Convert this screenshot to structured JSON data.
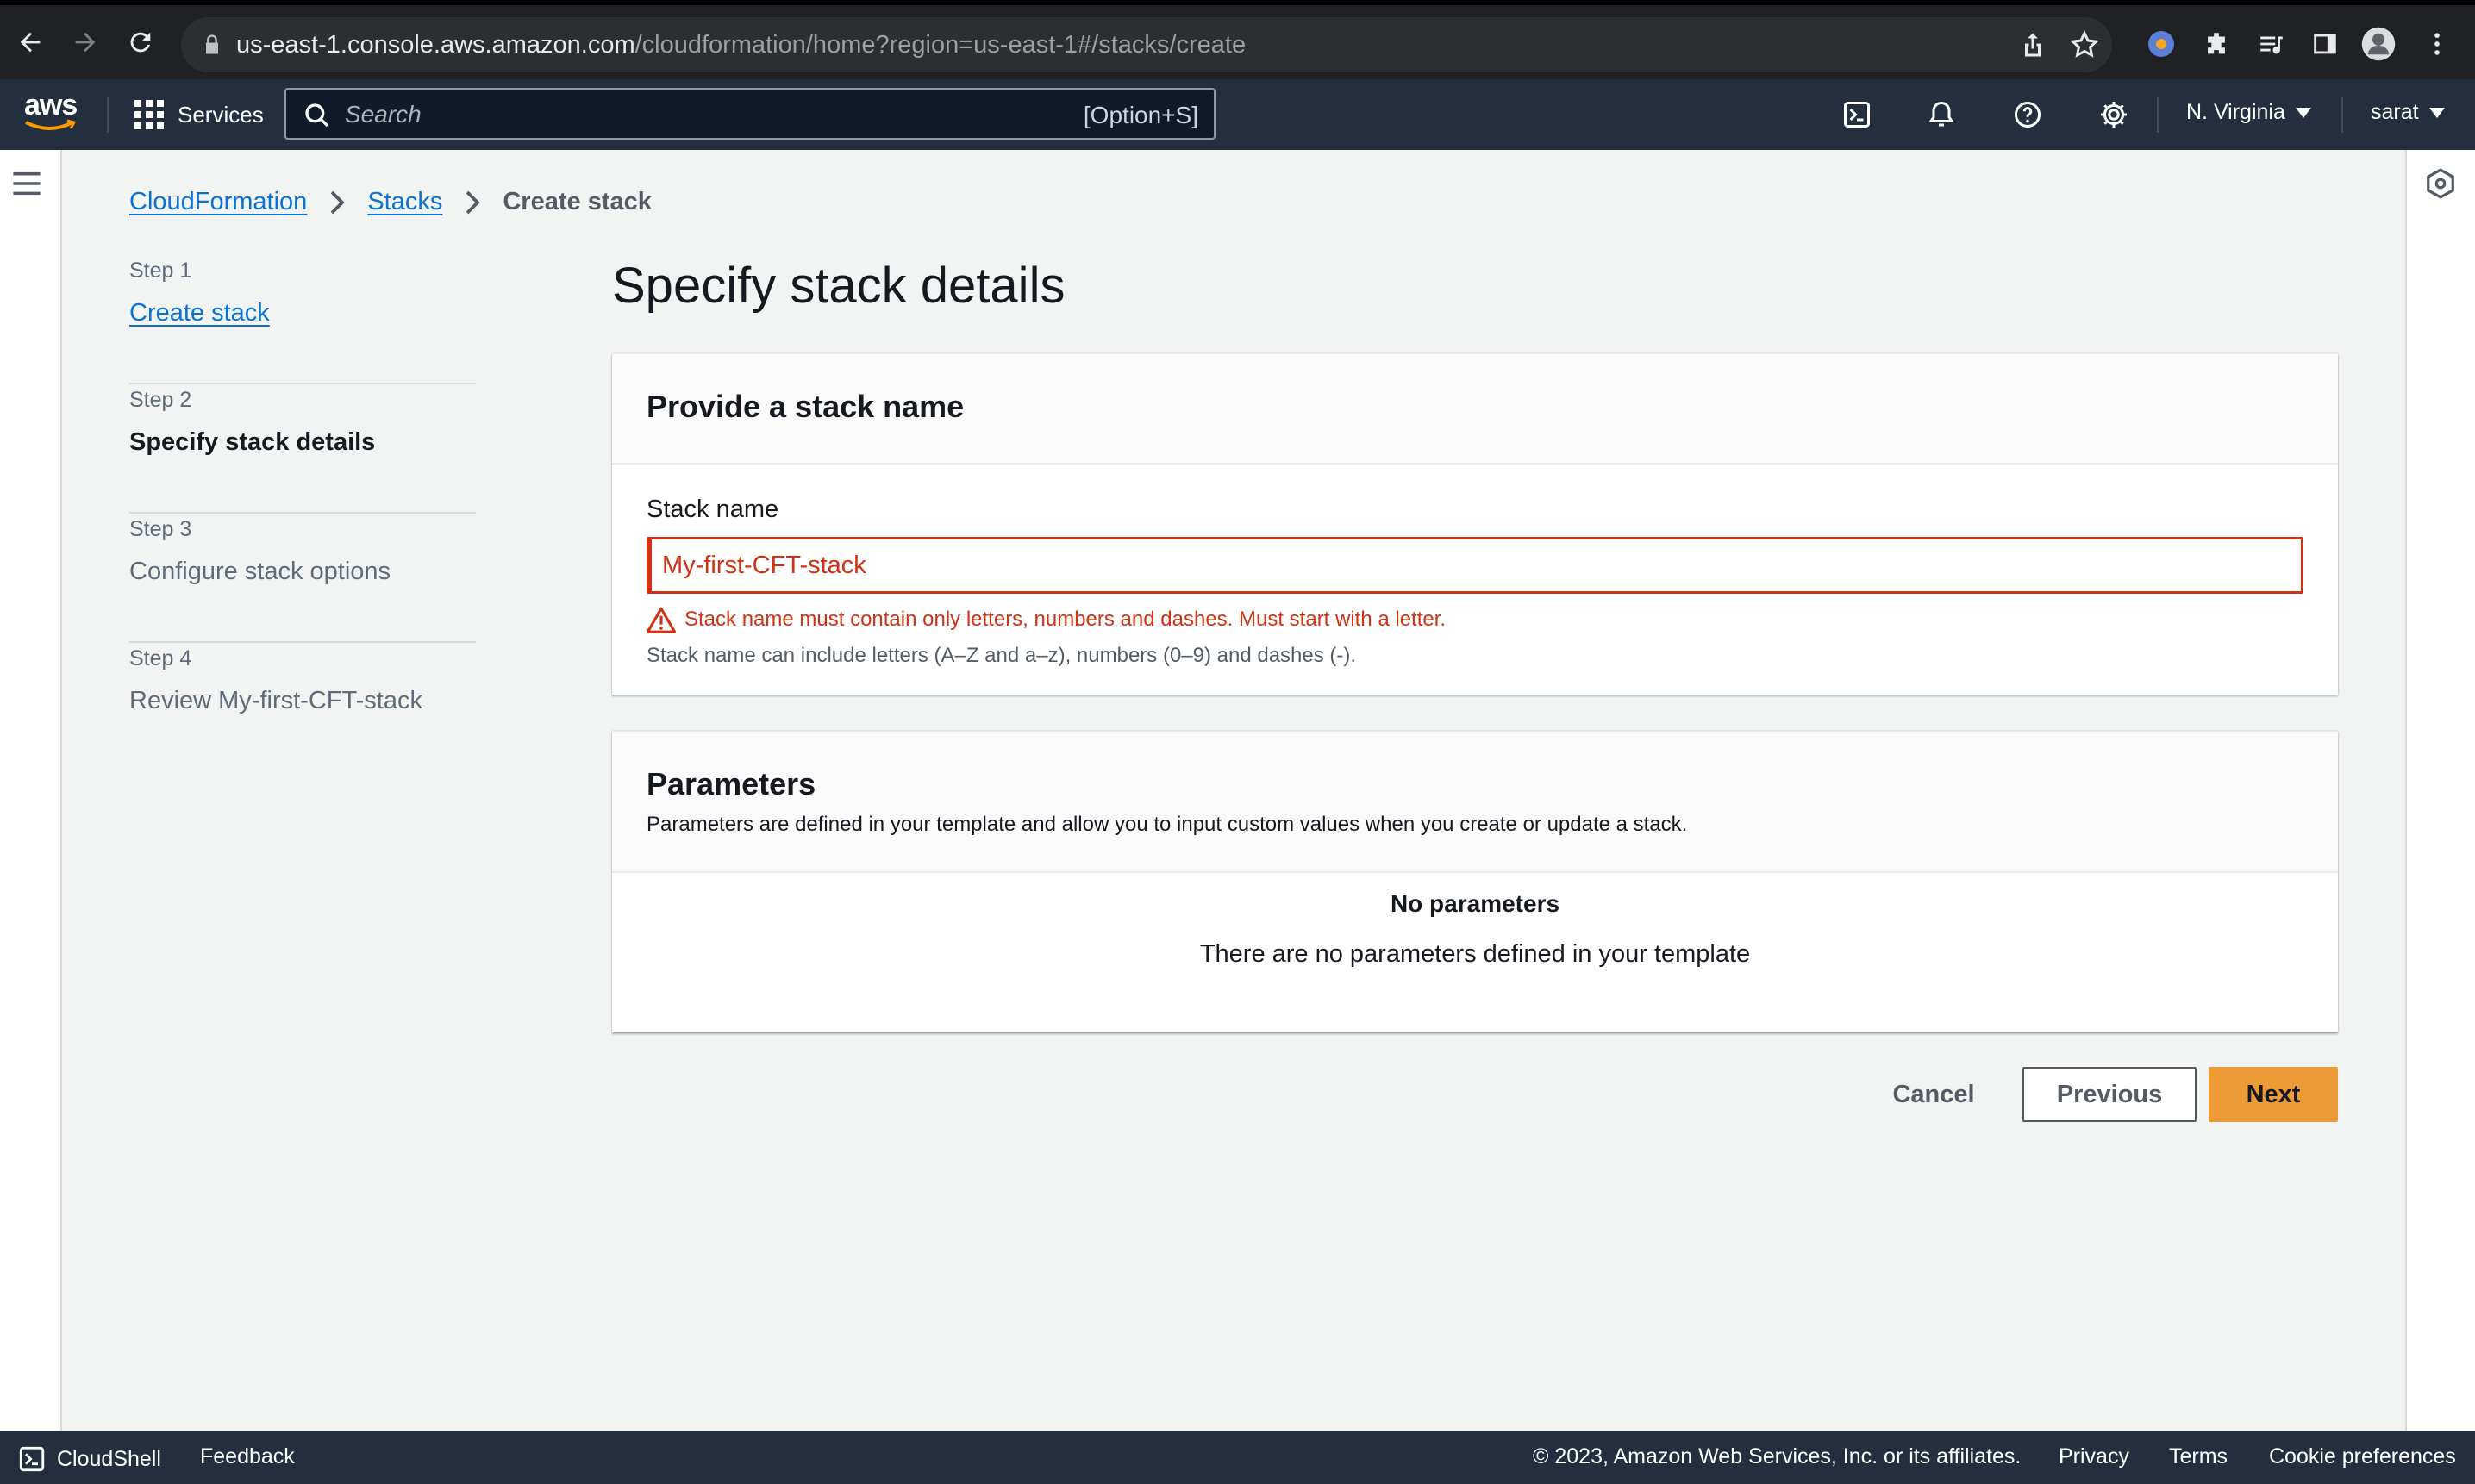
{
  "browser": {
    "url_host": "us-east-1.console.aws.amazon.com",
    "url_path": "/cloudformation/home?region=us-east-1#/stacks/create"
  },
  "header": {
    "logo_text": "aws",
    "services_label": "Services",
    "search_placeholder": "Search",
    "search_shortcut": "[Option+S]",
    "region_label": "N. Virginia",
    "user_label": "sarat"
  },
  "breadcrumb": {
    "items": [
      "CloudFormation",
      "Stacks"
    ],
    "current": "Create stack"
  },
  "steps": [
    {
      "number": "Step 1",
      "title": "Create stack"
    },
    {
      "number": "Step 2",
      "title": "Specify stack details"
    },
    {
      "number": "Step 3",
      "title": "Configure stack options"
    },
    {
      "number": "Step 4",
      "title": "Review My-first-CFT-stack"
    }
  ],
  "main": {
    "title": "Specify stack details",
    "stack_name_panel": {
      "heading": "Provide a stack name",
      "field_label": "Stack name",
      "field_value": "My-first-CFT-stack",
      "error": "Stack name must contain only letters, numbers and dashes. Must start with a letter.",
      "hint": "Stack name can include letters (A–Z and a–z), numbers (0–9) and dashes (-)."
    },
    "parameters_panel": {
      "heading": "Parameters",
      "description": "Parameters are defined in your template and allow you to input custom values when you create or update a stack.",
      "empty_title": "No parameters",
      "empty_text": "There are no parameters defined in your template"
    },
    "buttons": {
      "cancel": "Cancel",
      "previous": "Previous",
      "next": "Next"
    }
  },
  "footer": {
    "cloudshell": "CloudShell",
    "feedback": "Feedback",
    "copyright": "© 2023, Amazon Web Services, Inc. or its affiliates.",
    "privacy": "Privacy",
    "terms": "Terms",
    "cookies": "Cookie preferences"
  },
  "colors": {
    "header_bg": "#232f3e",
    "link": "#0972d3",
    "error": "#d13212",
    "primary_button": "#ec9b37"
  }
}
